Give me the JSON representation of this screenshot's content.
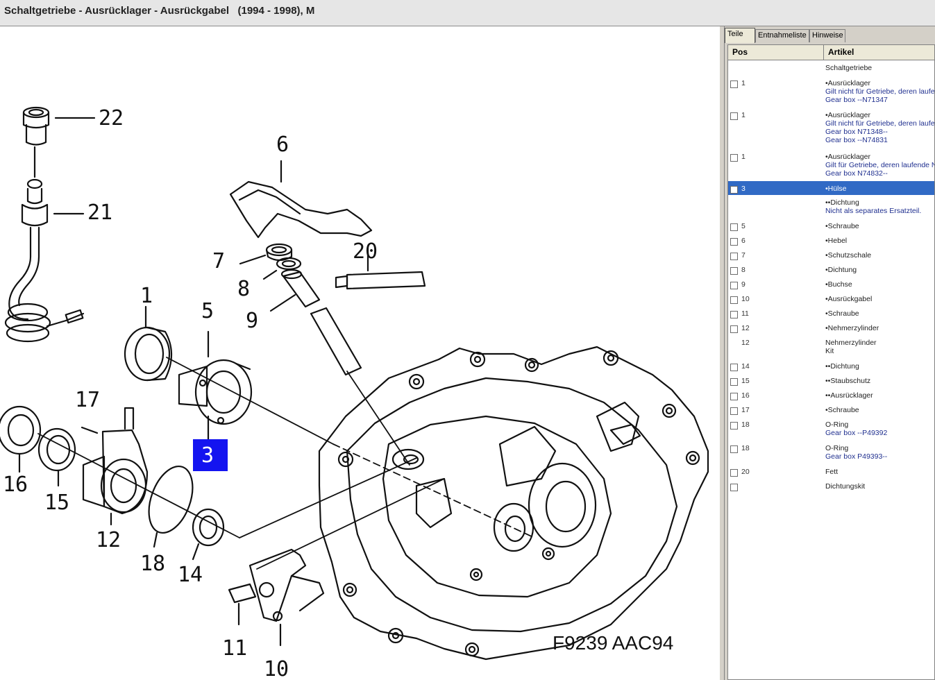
{
  "window": {
    "title": "Schaltgetriebe - Ausrücklager - Ausrückgabel   (1994 - 1998), M"
  },
  "diagram": {
    "code": "F9239 AAC94",
    "callouts": [
      {
        "label": "22"
      },
      {
        "label": "21"
      },
      {
        "label": "6"
      },
      {
        "label": "7"
      },
      {
        "label": "8"
      },
      {
        "label": "20"
      },
      {
        "label": "9"
      },
      {
        "label": "1"
      },
      {
        "label": "5"
      },
      {
        "label": "17"
      },
      {
        "label": "3",
        "highlight": true
      },
      {
        "label": "16"
      },
      {
        "label": "15"
      },
      {
        "label": "12"
      },
      {
        "label": "18"
      },
      {
        "label": "14"
      },
      {
        "label": "11"
      },
      {
        "label": "10"
      }
    ],
    "highlight_color": "#1414f0"
  },
  "panel": {
    "tabs": [
      {
        "label": "Teile",
        "active": true
      },
      {
        "label": "Entnahmeliste",
        "active": false
      },
      {
        "label": "Hinweise",
        "active": false
      }
    ],
    "columns": {
      "pos": "Pos",
      "artikel": "Artikel"
    },
    "selected_color": "#316ac5",
    "rows": [
      {
        "pos": "",
        "artikel": "Schaltgetriebe",
        "notes": [],
        "checkbox": false
      },
      {
        "pos": "1",
        "artikel": "•Ausrücklager",
        "notes": [
          "Gilt nicht für Getriebe, deren laufe",
          "Gear box --N71347"
        ],
        "checkbox": true
      },
      {
        "pos": "1",
        "artikel": "•Ausrücklager",
        "notes": [
          "Gilt nicht für Getriebe, deren laufe",
          "Gear box N71348--",
          "Gear box --N74831"
        ],
        "checkbox": true
      },
      {
        "pos": "1",
        "artikel": "•Ausrücklager",
        "notes": [
          "Gilt für Getriebe, deren laufende N",
          "Gear box N74832--"
        ],
        "checkbox": true
      },
      {
        "pos": "3",
        "artikel": "•Hülse",
        "notes": [],
        "checkbox": true,
        "selected": true
      },
      {
        "pos": "",
        "artikel": "••Dichtung",
        "notes": [
          "Nicht als separates Ersatzteil."
        ],
        "checkbox": false
      },
      {
        "pos": "5",
        "artikel": "•Schraube",
        "notes": [],
        "checkbox": true
      },
      {
        "pos": "6",
        "artikel": "•Hebel",
        "notes": [],
        "checkbox": true
      },
      {
        "pos": "7",
        "artikel": "•Schutzschale",
        "notes": [],
        "checkbox": true
      },
      {
        "pos": "8",
        "artikel": "•Dichtung",
        "notes": [],
        "checkbox": true
      },
      {
        "pos": "9",
        "artikel": "•Buchse",
        "notes": [],
        "checkbox": true
      },
      {
        "pos": "10",
        "artikel": "•Ausrückgabel",
        "notes": [],
        "checkbox": true
      },
      {
        "pos": "11",
        "artikel": "•Schraube",
        "notes": [],
        "checkbox": true
      },
      {
        "pos": "12",
        "artikel": "•Nehmerzylinder",
        "notes": [],
        "checkbox": true
      },
      {
        "pos": "12",
        "artikel": "Nehmerzylinder",
        "notes": [
          "Kit"
        ],
        "checkbox": false,
        "plain_note": true
      },
      {
        "pos": "14",
        "artikel": "••Dichtung",
        "notes": [],
        "checkbox": true
      },
      {
        "pos": "15",
        "artikel": "••Staubschutz",
        "notes": [],
        "checkbox": true
      },
      {
        "pos": "16",
        "artikel": "••Ausrücklager",
        "notes": [],
        "checkbox": true
      },
      {
        "pos": "17",
        "artikel": "•Schraube",
        "notes": [],
        "checkbox": true
      },
      {
        "pos": "18",
        "artikel": "O-Ring",
        "notes": [
          "Gear box --P49392"
        ],
        "checkbox": true
      },
      {
        "pos": "18",
        "artikel": "O-Ring",
        "notes": [
          "Gear box P49393--"
        ],
        "checkbox": true
      },
      {
        "pos": "20",
        "artikel": "Fett",
        "notes": [],
        "checkbox": true
      },
      {
        "pos": "",
        "artikel": "Dichtungskit",
        "notes": [],
        "checkbox": true
      }
    ]
  }
}
